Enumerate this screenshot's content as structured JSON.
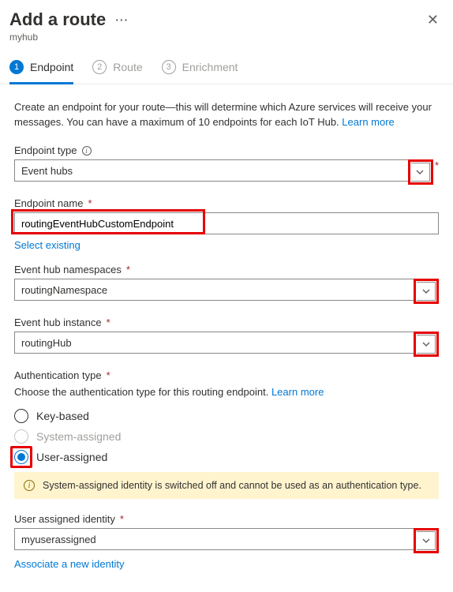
{
  "header": {
    "title": "Add a route",
    "subtitle": "myhub"
  },
  "tabs": [
    {
      "num": "1",
      "label": "Endpoint",
      "active": true
    },
    {
      "num": "2",
      "label": "Route",
      "active": false
    },
    {
      "num": "3",
      "label": "Enrichment",
      "active": false
    }
  ],
  "intro": {
    "text": "Create an endpoint for your route—this will determine which Azure services will receive your messages. You can have a maximum of 10 endpoints for each IoT Hub. ",
    "link": "Learn more"
  },
  "fields": {
    "endpoint_type": {
      "label": "Endpoint type",
      "value": "Event hubs"
    },
    "endpoint_name": {
      "label": "Endpoint name",
      "value": "routingEventHubCustomEndpoint",
      "select_existing": "Select existing"
    },
    "namespace": {
      "label": "Event hub namespaces",
      "value": "routingNamespace"
    },
    "instance": {
      "label": "Event hub instance",
      "value": "routingHub"
    },
    "auth_type": {
      "label": "Authentication type",
      "desc_pre": "Choose the authentication type for this routing endpoint. ",
      "desc_link": "Learn more"
    },
    "auth_options": {
      "key": "Key-based",
      "system": "System-assigned",
      "user": "User-assigned"
    },
    "info_bar": "System-assigned identity is switched off and cannot be used as an authentication type.",
    "user_identity": {
      "label": "User assigned identity",
      "value": "myuserassigned",
      "associate": "Associate a new identity"
    }
  },
  "glyphs": {
    "star": "*"
  }
}
